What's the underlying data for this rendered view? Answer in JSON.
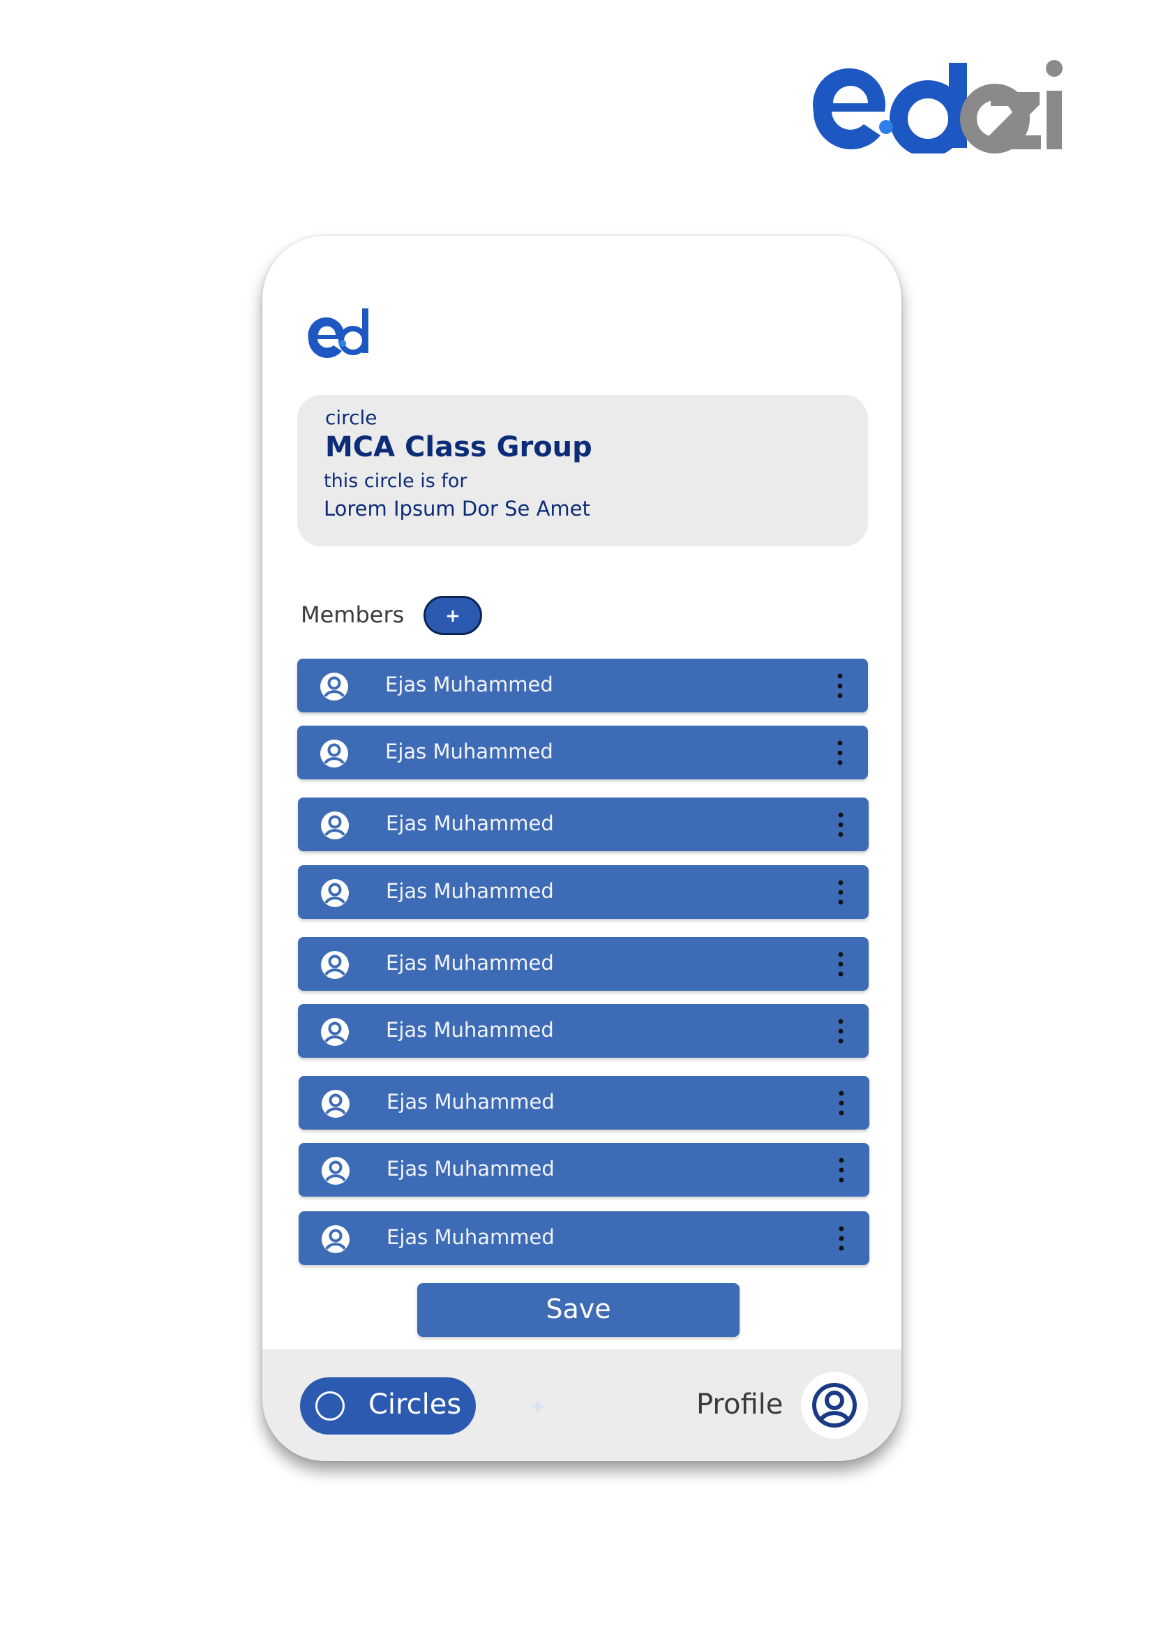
{
  "brand": {
    "logo_text": "eddzi",
    "accent": "#1c57c2",
    "secondary": "#8a8a8a"
  },
  "app": {
    "logo_text": "ed"
  },
  "circle": {
    "tag": "circle",
    "name": "MCA Class Group",
    "description_label": "this circle is for",
    "description": "Lorem Ipsum Dor Se Amet"
  },
  "members": {
    "label": "Members",
    "add_button": "+",
    "items": [
      {
        "name": "Ejas Muhammed",
        "avatar_icon": "user-icon",
        "menu_icon": "more-vertical-icon"
      },
      {
        "name": "Ejas Muhammed",
        "avatar_icon": "user-icon",
        "menu_icon": "more-vertical-icon"
      },
      {
        "name": "Ejas Muhammed",
        "avatar_icon": "user-icon",
        "menu_icon": "more-vertical-icon"
      },
      {
        "name": "Ejas Muhammed",
        "avatar_icon": "user-icon",
        "menu_icon": "more-vertical-icon"
      },
      {
        "name": "Ejas Muhammed",
        "avatar_icon": "user-icon",
        "menu_icon": "more-vertical-icon"
      },
      {
        "name": "Ejas Muhammed",
        "avatar_icon": "user-icon",
        "menu_icon": "more-vertical-icon"
      },
      {
        "name": "Ejas Muhammed",
        "avatar_icon": "user-icon",
        "menu_icon": "more-vertical-icon"
      },
      {
        "name": "Ejas Muhammed",
        "avatar_icon": "user-icon",
        "menu_icon": "more-vertical-icon"
      },
      {
        "name": "Ejas Muhammed",
        "avatar_icon": "user-icon",
        "menu_icon": "more-vertical-icon"
      }
    ]
  },
  "actions": {
    "save_label": "Save"
  },
  "nav": {
    "circles_label": "Circles",
    "profile_label": "Profile",
    "active_tab": "Circles"
  },
  "colors": {
    "primary": "#3d6bb5",
    "primary_dark": "#2c5ab0",
    "navy": "#0c2c78",
    "card_bg": "#ebebeb"
  }
}
